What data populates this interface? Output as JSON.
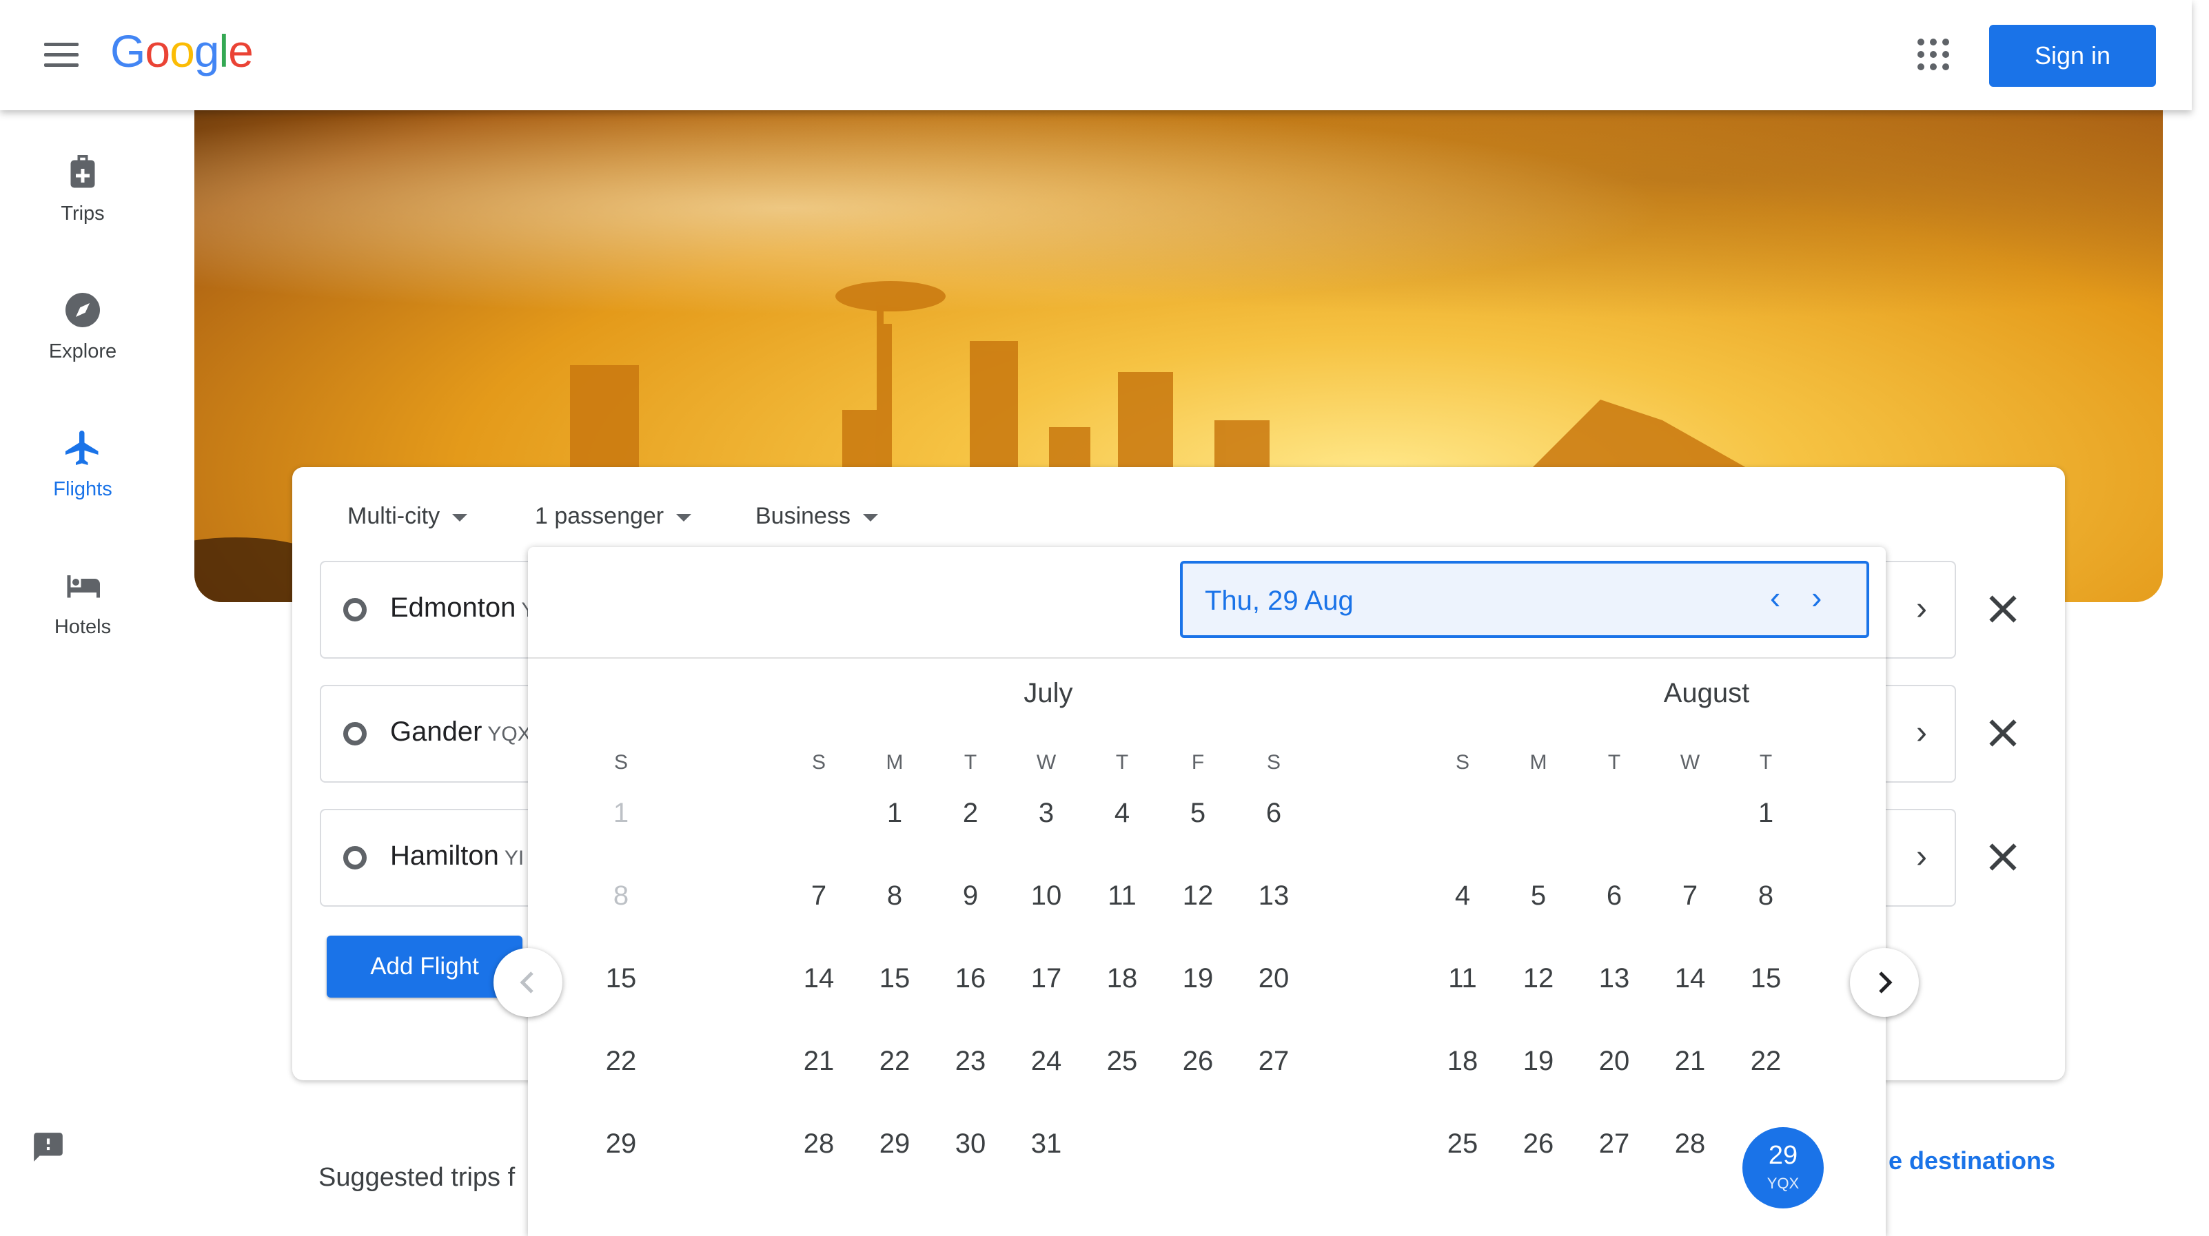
{
  "header": {
    "logo": [
      "G",
      "o",
      "o",
      "g",
      "l",
      "e"
    ],
    "logo_colors": [
      "#4285f4",
      "#ea4335",
      "#fbbc05",
      "#4285f4",
      "#34a853",
      "#ea4335"
    ],
    "sign_in_label": "Sign in"
  },
  "sidebar": {
    "items": [
      {
        "label": "Trips",
        "icon": "luggage-icon",
        "active": false
      },
      {
        "label": "Explore",
        "icon": "compass-icon",
        "active": false
      },
      {
        "label": "Flights",
        "icon": "airplane-icon",
        "active": true
      },
      {
        "label": "Hotels",
        "icon": "bed-icon",
        "active": false
      }
    ]
  },
  "search": {
    "trip_type": "Multi-city",
    "passengers": "1 passenger",
    "cabin_class": "Business",
    "legs": [
      {
        "origin": "Edmonton",
        "code": "Y"
      },
      {
        "origin": "Gander",
        "code": "YQX"
      },
      {
        "origin": "Hamilton",
        "code": "YI"
      }
    ],
    "add_flight_label": "Add Flight"
  },
  "calendar": {
    "selected_date": "Thu, 29 Aug",
    "partial_month": {
      "dow": "S",
      "days": [
        "1",
        "8",
        "15",
        "22",
        "29"
      ]
    },
    "months": [
      {
        "name": "July",
        "dow": [
          "S",
          "M",
          "T",
          "W",
          "T",
          "F",
          "S"
        ]
      },
      {
        "name": "August",
        "dow": [
          "S",
          "M",
          "T",
          "W",
          "T"
        ]
      }
    ],
    "july_rows": [
      [
        "",
        "1",
        "2",
        "3",
        "4",
        "5",
        "6"
      ],
      [
        "7",
        "8",
        "9",
        "10",
        "11",
        "12",
        "13"
      ],
      [
        "14",
        "15",
        "16",
        "17",
        "18",
        "19",
        "20"
      ],
      [
        "21",
        "22",
        "23",
        "24",
        "25",
        "26",
        "27"
      ],
      [
        "28",
        "29",
        "30",
        "31",
        "",
        "",
        ""
      ]
    ],
    "august_rows": [
      [
        "",
        "",
        "",
        "",
        "1"
      ],
      [
        "4",
        "5",
        "6",
        "7",
        "8"
      ],
      [
        "11",
        "12",
        "13",
        "14",
        "15"
      ],
      [
        "18",
        "19",
        "20",
        "21",
        "22"
      ],
      [
        "25",
        "26",
        "27",
        "28",
        "29"
      ]
    ],
    "selected_day": {
      "day": "29",
      "code": "YQX"
    }
  },
  "footer": {
    "suggested_trips": "Suggested trips f",
    "explore_link": "e destinations"
  },
  "colors": {
    "accent": "#1a73e8"
  }
}
